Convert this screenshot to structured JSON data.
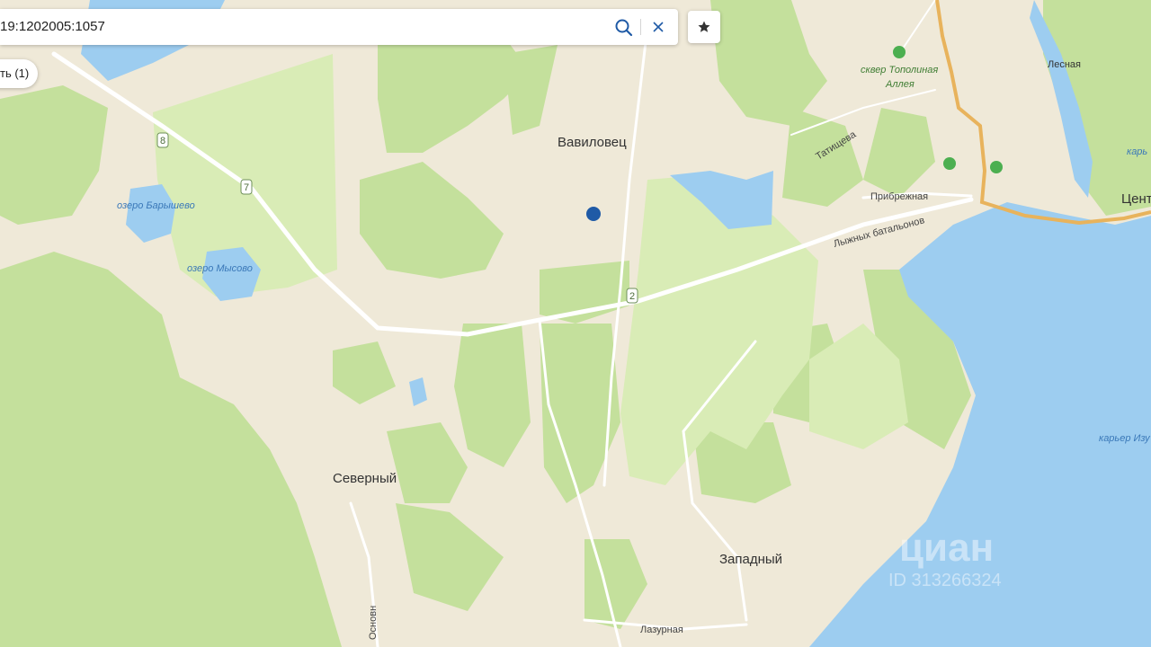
{
  "search": {
    "value": "19:1202005:1057"
  },
  "filter_chip": {
    "label": "ть (1)"
  },
  "labels": {
    "vavilovets": "Вавиловец",
    "severny": "Северный",
    "zapadny": "Западный",
    "lake_baryshevo": "озеро Барышево",
    "lake_mysovo": "озеро Мысово",
    "tatishcheva": "Татищева",
    "pribrezhnaya": "Прибрежная",
    "lyzhnykh": "Лыжных батальонов",
    "lazurnaya": "Лазурная",
    "osnovnaya": "Основн",
    "lesnaya": "Лесная",
    "sker_line1": "сквер Тополиная",
    "sker_line2": "Аллея",
    "karer_top": "карь",
    "karer_right": "карьер Изу",
    "tsent": "Цент"
  },
  "route_shields": [
    "8",
    "7",
    "2"
  ],
  "watermark": {
    "brand": "циан",
    "id": "ID 313266324"
  },
  "colors": {
    "land": "#efe9d8",
    "park": "#cfe4a8",
    "forest": "#b6d98a",
    "water": "#9dcdf0",
    "road": "#ffffff",
    "highway": "#e8b35c",
    "marker": "#1f5aa6"
  },
  "marker": {
    "type": "selected-plot"
  }
}
